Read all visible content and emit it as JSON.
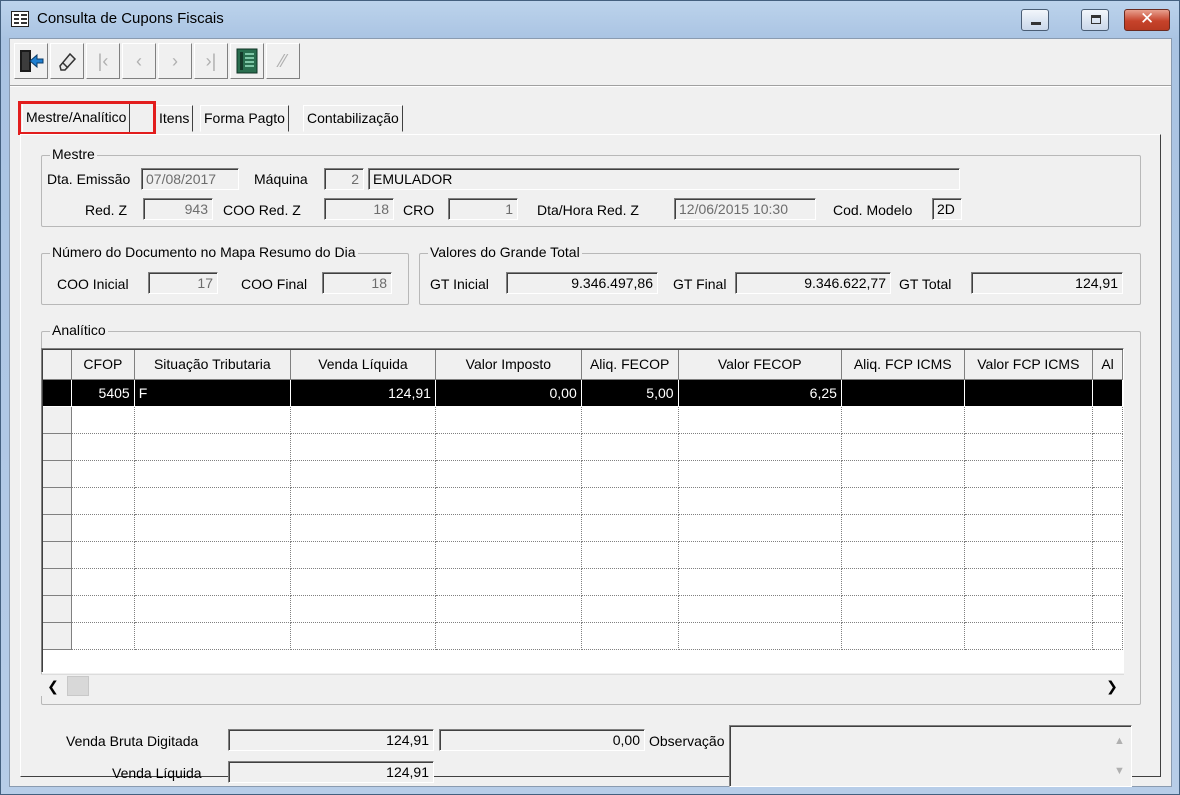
{
  "window": {
    "title": "Consulta de Cupons Fiscais"
  },
  "tabs": [
    "Mestre/Analítico",
    "Itens",
    "Forma Pagto",
    "Contabilização"
  ],
  "mestre": {
    "label": "Mestre",
    "dta_emissao_label": "Dta. Emissão",
    "dta_emissao": "07/08/2017",
    "maquina_label": "Máquina",
    "maquina_num": "2",
    "maquina_nome": "EMULADOR",
    "redz_label": "Red. Z",
    "redz": "943",
    "coo_redz_label": "COO Red. Z",
    "coo_redz": "18",
    "cro_label": "CRO",
    "cro": "1",
    "dta_hora_redz_label": "Dta/Hora Red. Z",
    "dta_hora_redz": "12/06/2015 10:30",
    "cod_modelo_label": "Cod. Modelo",
    "cod_modelo": "2D"
  },
  "mapa": {
    "label": "Número do Documento no Mapa Resumo do Dia",
    "coo_inicial_label": "COO Inicial",
    "coo_inicial": "17",
    "coo_final_label": "COO Final",
    "coo_final": "18"
  },
  "grande_total": {
    "label": "Valores do Grande Total",
    "gt_inicial_label": "GT Inicial",
    "gt_inicial": "9.346.497,86",
    "gt_final_label": "GT Final",
    "gt_final": "9.346.622,77",
    "gt_total_label": "GT Total",
    "gt_total": "124,91"
  },
  "analitico": {
    "label": "Analítico",
    "columns": [
      "CFOP",
      "Situação Tributaria",
      "Venda Líquida",
      "Valor Imposto",
      "Aliq. FECOP",
      "Valor FECOP",
      "Aliq. FCP ICMS",
      "Valor FCP ICMS",
      "Al"
    ],
    "rows": [
      [
        "5405",
        "F",
        "124,91",
        "0,00",
        "5,00",
        "6,25",
        "",
        "",
        ""
      ]
    ]
  },
  "footer": {
    "venda_bruta_label": "Venda Bruta Digitada",
    "venda_bruta": "124,91",
    "desconto": "0,00",
    "observacao_label": "Observação",
    "venda_liquida_label": "Venda Líquida",
    "venda_liquida": "124,91"
  },
  "toolbar": {
    "icons": [
      "exit-icon",
      "eraser-icon",
      "first-record-icon",
      "previous-record-icon",
      "next-record-icon",
      "last-record-icon",
      "document-icon",
      "reprocess-icon"
    ]
  },
  "colors": {
    "highlight": "#e21d1d",
    "selected_row": "#000000"
  }
}
